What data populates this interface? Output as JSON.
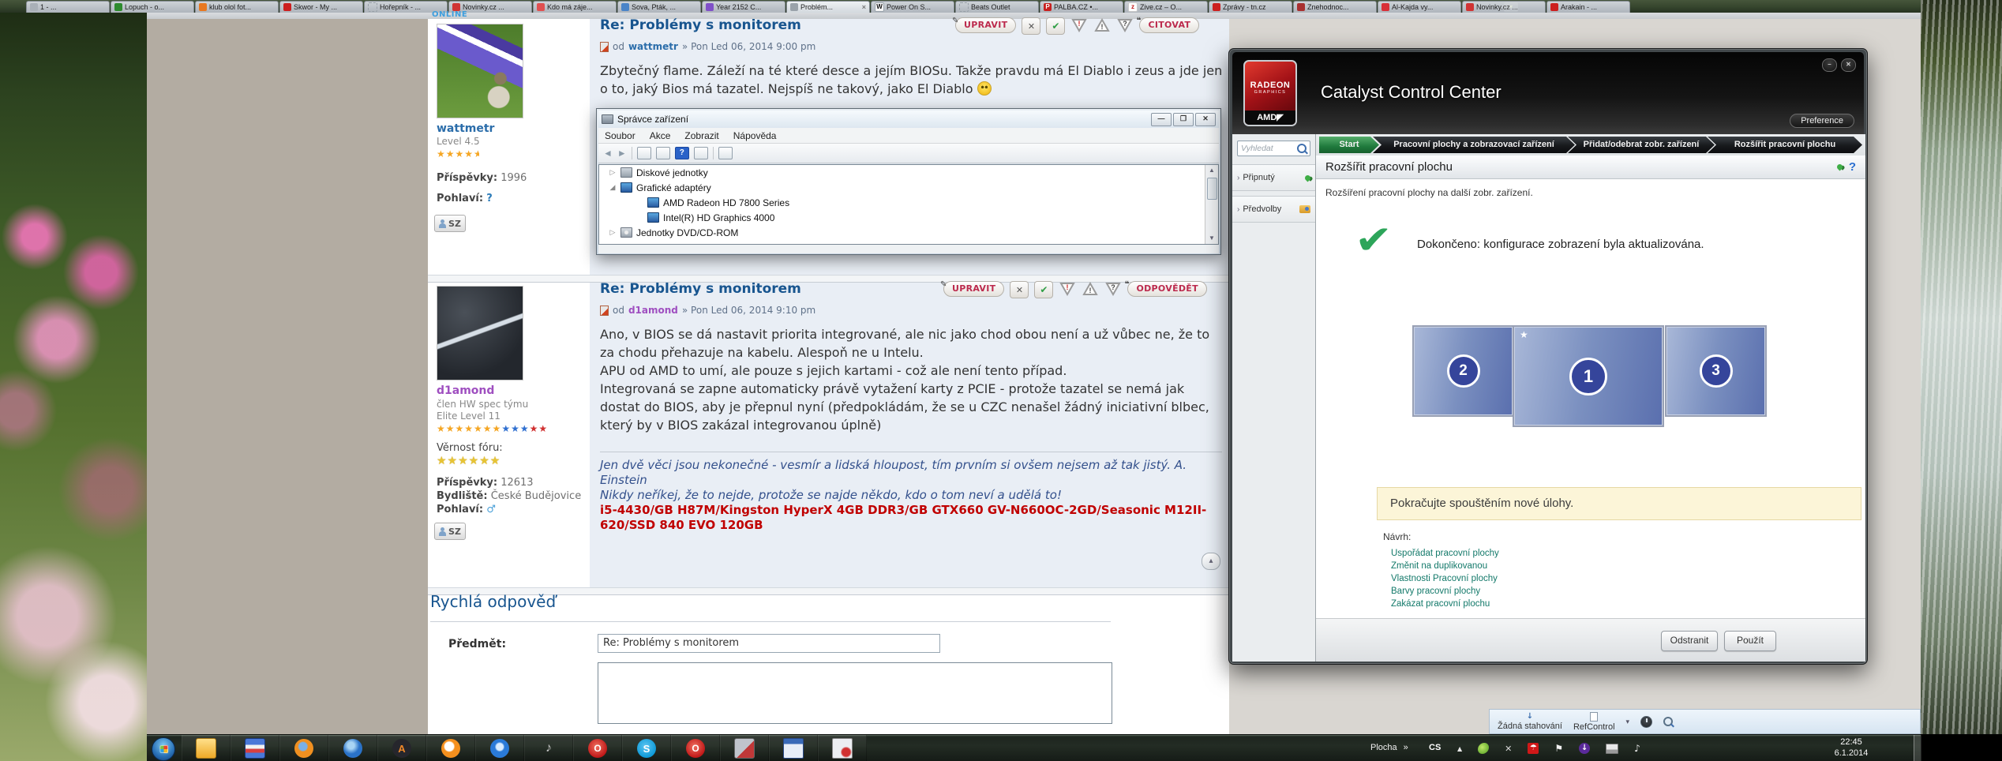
{
  "browser": {
    "new_tab_list_button": "▾",
    "tabs": [
      {
        "cls": "tab",
        "fav": "background:#a9b0b7",
        "glyph": "",
        "label": "1 - ...",
        "close": ""
      },
      {
        "cls": "tab",
        "fav": "background:#2e8b2e",
        "glyph": "",
        "label": "Lopuch - o...",
        "close": ""
      },
      {
        "cls": "tab",
        "fav": "background:#e87820",
        "glyph": "",
        "label": "klub olol fot...",
        "close": ""
      },
      {
        "cls": "tab",
        "fav": "background:#cc1f1f",
        "glyph": "",
        "label": "Skwor - My ...",
        "close": ""
      },
      {
        "cls": "tab",
        "fav": "border:1px dashed #98a0a8",
        "glyph": "",
        "label": "Hořepník - ...",
        "close": ""
      },
      {
        "cls": "tab",
        "fav": "background:#d03434",
        "glyph": "",
        "label": "Novinky.cz ...",
        "close": ""
      },
      {
        "cls": "tab",
        "fav": "background:#e05050",
        "glyph": "",
        "label": "Kdo má záje...",
        "close": ""
      },
      {
        "cls": "tab",
        "fav": "background:#4a84c8",
        "glyph": "",
        "label": "Sova, Pták, ...",
        "close": ""
      },
      {
        "cls": "tab",
        "fav": "background:#8050c8",
        "glyph": "",
        "label": "Year 2152 C...",
        "close": ""
      },
      {
        "cls": "tab active",
        "fav": "background:#9aa2aa",
        "glyph": "",
        "label": "Problém...",
        "close": "×"
      },
      {
        "cls": "tab",
        "fav": "background:#f5f5f5;color:#111;border:1px solid #9aa4ac",
        "glyph": "W",
        "label": "Power On S...",
        "close": ""
      },
      {
        "cls": "tab",
        "fav": "border:1px dashed #98a0a8",
        "glyph": "",
        "label": "Beats Outlet",
        "close": ""
      },
      {
        "cls": "tab",
        "fav": "background:#c82020",
        "glyph": "P",
        "label": "PALBA.CZ •...",
        "close": ""
      },
      {
        "cls": "tab",
        "fav": "background:#ffffff;color:#c01818;border:1px solid #c9c9c9",
        "glyph": "z",
        "label": "Zive.cz – O...",
        "close": ""
      },
      {
        "cls": "tab",
        "fav": "background:#cc1f1f",
        "glyph": "",
        "label": "Zprávy - tn.cz",
        "close": ""
      },
      {
        "cls": "tab",
        "fav": "background:#a83030",
        "glyph": "",
        "label": "Znehodnoc...",
        "close": ""
      },
      {
        "cls": "tab",
        "fav": "background:#d83038",
        "glyph": "",
        "label": "Al-Kajda vy...",
        "close": ""
      },
      {
        "cls": "tab",
        "fav": "background:#d03434",
        "glyph": "",
        "label": "Novinky.cz ...",
        "close": ""
      },
      {
        "cls": "tab",
        "fav": "background:#cc1f1f",
        "glyph": "",
        "label": "Arakain - ...",
        "close": ""
      }
    ],
    "addon_bar": {
      "downloads_icon": "↓",
      "downloads_label": "Žádná stahování",
      "refcontrol_label": "RefControl",
      "caret": "▾"
    }
  },
  "forum": {
    "post_buttons": {
      "edit": "UPRAVIT",
      "edit_pre": "✎",
      "delete": "✕",
      "approve": "✔",
      "report": "!",
      "warn": "!",
      "question": "?",
      "quote": "CITOVAT",
      "quote_pre": "❝",
      "reply": "ODPOVĚDĚT",
      "reply_pre": "❝"
    },
    "post1": {
      "online_badge": "ONLINE",
      "title": "Re: Problémy s monitorem",
      "meta_od": "od",
      "author": "wattmetr",
      "meta_rest": "» Pon Led 06, 2014 9:00 pm",
      "body": "Zbytečný flame. Záleží na té které desce a jejím BIOSu. Takže pravdu má El Diablo i zeus a jde jen o to, jaký Bios má tazatel. Nejspíš ne takový, jako El Diablo",
      "profile": {
        "username": "wattmetr",
        "rank": "Level 4.5",
        "stars_full": "★★★★",
        "star_half": "★",
        "posts_label": "Příspěvky:",
        "posts": "1996",
        "gender_label": "Pohlaví:",
        "gender": "?",
        "pm_button": "SZ"
      }
    },
    "post2": {
      "title": "Re: Problémy s monitorem",
      "meta_od": "od",
      "author": "d1amond",
      "meta_rest": "» Pon Led 06, 2014 9:10 pm",
      "body": "Ano, v BIOS se dá nastavit priorita integrované, ale nic jako chod obou není a už vůbec ne, že to za chodu přehazuje na kabelu. Alespoň ne u Intelu.\nAPU od AMD to umí, ale pouze s jejich kartami - což ale není tento případ.\nIntegrovaná se zapne automaticky právě vytažení karty z PCIE - protože tazatel se nemá jak dostat do BIOS, aby je přepnul nyní (předpokládám, že se u CZC nenašel žádný iniciativní blbec, který by v BIOS zakázal integrovanou úplně)",
      "sig_line1": "Jen dvě věci jsou nekonečné - vesmír a lidská hloupost, tím prvním si ovšem nejsem až tak jistý. A. Einstein",
      "sig_line2": "Nikdy neříkej, že to nejde, protože se najde někdo, kdo o tom neví a udělá to!",
      "sig_hw": "i5-4430/GB H87M/Kingston HyperX 4GB DDR3/GB GTX660 GV-N660OC-2GD/Seasonic M12II-620/SSD 840 EVO 120GB",
      "profile": {
        "username": "d1amond",
        "rank1": "člen HW spec týmu",
        "rank2": "Elite Level 11",
        "stars_orange": "★★★★★★★",
        "stars_blue": "★★★",
        "stars_red": "★★",
        "loyalty_label": "Věrnost fóru:",
        "loyalty_stars": "★★★★★★",
        "posts_label": "Příspěvky:",
        "posts": "12613",
        "location_label": "Bydliště:",
        "location": "České Budějovice",
        "gender_label": "Pohlaví:",
        "gender": "♂",
        "pm_button": "SZ"
      }
    },
    "to_top": "▴",
    "quick_reply": {
      "heading": "Rychlá odpověď",
      "subject_label": "Předmět:",
      "subject_value": "Re: Problémy s monitorem"
    }
  },
  "device_manager": {
    "title": "Správce zařízení",
    "caption_buttons": {
      "min": "—",
      "max": "❐",
      "close": "✕"
    },
    "menu": [
      "Soubor",
      "Akce",
      "Zobrazit",
      "Nápověda"
    ],
    "nav_back": "◄",
    "nav_fwd": "►",
    "help_glyph": "?",
    "scroll_up": "▲",
    "scroll_down": "▼",
    "tree": [
      {
        "expander": "▷",
        "icon_cls": "ticon icon-disk",
        "label": "Diskové jednotky",
        "row_style": "padding-left:12px"
      },
      {
        "expander": "◢",
        "icon_cls": "ticon icon-gpu",
        "label": "Grafické adaptéry",
        "row_style": "padding-left:12px"
      },
      {
        "expander": "",
        "icon_cls": "ticon icon-gpu",
        "label": "AMD Radeon HD 7800 Series",
        "row_style": "padding-left:46px"
      },
      {
        "expander": "",
        "icon_cls": "ticon icon-gpu",
        "label": "Intel(R) HD Graphics 4000",
        "row_style": "padding-left:46px"
      },
      {
        "expander": "▷",
        "icon_cls": "ticon icon-dvd",
        "label": "Jednotky DVD/CD-ROM",
        "row_style": "padding-left:12px"
      }
    ]
  },
  "ccc": {
    "logo_line1": "RADEON",
    "logo_line2": "GRAPHICS",
    "logo_brand": "AMD◤",
    "window_title": "Catalyst Control Center",
    "caption_min": "–",
    "caption_close": "✕",
    "preference_button": "Preference",
    "search_placeholder": "Vyhledat",
    "sidebar": [
      {
        "chev": "›",
        "label": "Připnutý"
      },
      {
        "chev": "›",
        "label": "Předvolby"
      }
    ],
    "breadcrumbs": [
      "Start",
      "Pracovní plochy a zobrazovací zařízení",
      "Přidat/odebrat zobr. zařízení",
      "Rozšířit pracovní plochu"
    ],
    "panel_title": "Rozšířit pracovní plochu",
    "help_glyph": "?",
    "description": "Rozšíření pracovní plochy na další zobr. zařízení.",
    "check_glyph": "✔",
    "status_done": "Dokončeno: konfigurace zobrazení byla aktualizována.",
    "monitors": [
      {
        "n": "2",
        "star": ""
      },
      {
        "n": "1",
        "star": "★"
      },
      {
        "n": "3",
        "star": ""
      }
    ],
    "banner": "Pokračujte spouštěním nové úlohy.",
    "suggestions_label": "Návrh:",
    "suggestions": [
      "Uspořádat pracovní plochy",
      "Změnit na duplikovanou",
      "Vlastnosti Pracovní plochy",
      "Barvy pracovní plochy",
      "Zakázat pracovní plochu"
    ],
    "remove_button": "Odstranit",
    "apply_button": "Použít",
    "accent_green": "#1f7a3c",
    "monitor_blue": "#35459b"
  },
  "taskbar": {
    "plocha_label": "Plocha",
    "plocha_chevrons": "»",
    "language": "CS",
    "clock_time": "22:45",
    "clock_date": "6.1.2014",
    "apps": [
      {
        "name": "explorer-icon",
        "style": "background:linear-gradient(180deg,#ffe08a,#eda928);border-radius:3px;border:1px solid #a87818",
        "glyph": ""
      },
      {
        "name": "total-commander-icon",
        "style": "background:linear-gradient(180deg,#4a78d8 0,#4a78d8 32%,#f2f2f2 32%,#f2f2f2 52%,#d84040 52%,#d84040 72%,#4a78d8 72%);border-radius:3px;border:1px solid #1a3a80",
        "glyph": ""
      },
      {
        "name": "firefox-icon",
        "style": "background:radial-gradient(circle at 45% 40%,#7ab0e8 0 26%,#f09020 34% 78%,#b85a10 90%);border-radius:50%",
        "glyph": ""
      },
      {
        "name": "thunderbird-icon",
        "style": "background:radial-gradient(circle at 40% 35%,#a8d4f4 0 20%,#2a72c8 50%);border-radius:50%",
        "glyph": ""
      },
      {
        "name": "aimp-icon",
        "style": "background:#26262c;border-radius:50%;color:#f08828;font-weight:bold;font-size:13px",
        "glyph": "A"
      },
      {
        "name": "gom-player-icon",
        "style": "background:radial-gradient(circle at 42% 40%,#ffffff 0 28%,#f5901e 36%);border-radius:50%",
        "glyph": ""
      },
      {
        "name": "media-player-icon",
        "style": "background:radial-gradient(circle at 50% 42%,#d8ecff 0 24%,#2a7ad8 34%);border-radius:50%",
        "glyph": ""
      },
      {
        "name": "speaker-icon",
        "style": "color:#c8c8c8;font-size:16px",
        "glyph": "♪"
      },
      {
        "name": "opera-icon",
        "style": "background:radial-gradient(circle at 45% 40%,#f07060,#c01818 70%);border-radius:50%;color:#fff;font-weight:bold;font-size:12px",
        "glyph": "O"
      },
      {
        "name": "skype-icon",
        "style": "background:radial-gradient(circle at 45% 40%,#5ec6f2,#0e9ad8 70%);border-radius:50%;color:#fff;font-weight:bold;font-size:13px",
        "glyph": "S"
      },
      {
        "name": "opera2-icon",
        "style": "background:radial-gradient(circle at 45% 40%,#f07060,#c01818 70%);border-radius:50%;color:#fff;font-weight:bold;font-size:12px",
        "glyph": "O"
      },
      {
        "name": "hardware-tool-icon",
        "style": "background:linear-gradient(135deg,#c0c4cc 0 55%,#c03838 55%);border-radius:3px;border:1px solid #666",
        "glyph": ""
      },
      {
        "name": "management-console-icon",
        "style": "background:linear-gradient(180deg,#3a6ab8 0 28%,#e8eef8 28%);border-radius:2px;border:1px solid #2a4a88",
        "glyph": ""
      },
      {
        "name": "uninstaller-icon",
        "style": "background:radial-gradient(circle at 70% 70%,#d03030 0 22%,#eceef2 30%);border-radius:2px;border:1px solid #888",
        "glyph": ""
      }
    ],
    "tray": [
      {
        "name": "hidden-icons-button",
        "style": "color:#e8e8e8;font-size:8px",
        "glyph": "▲"
      },
      {
        "name": "leaf-icon",
        "style": "width:14px;height:14px;background:radial-gradient(circle at 40% 40%,#bfe868,#4a9a1e);border-radius:60% 40% 60% 40%",
        "glyph": ""
      },
      {
        "name": "x-tool-icon",
        "style": "color:#d8d8d8;font-size:11px;font-weight:bold",
        "glyph": "✕"
      },
      {
        "name": "avira-icon",
        "style": "width:14px;height:14px;background:#d01818;border-radius:2px;color:#fff;font-size:10px;line-height:14px;text-align:center",
        "glyph": "☂"
      },
      {
        "name": "action-center-flag-icon",
        "style": "color:#f0f0f0;font-size:12px",
        "glyph": "⚑"
      },
      {
        "name": "download-manager-icon",
        "style": "width:14px;height:14px;background:#5a2a9a;border-radius:50%;color:#fff;font-size:10px;line-height:14px;text-align:center;font-weight:bold",
        "glyph": "↓"
      },
      {
        "name": "network-icon",
        "style": "width:14px;height:11px;background:linear-gradient(180deg,#e8e8e8 0 60%,#9a9a9a 60%);border:1px solid #777;border-radius:1px",
        "glyph": ""
      },
      {
        "name": "volume-icon",
        "style": "color:#e8e8e8;font-size:12px",
        "glyph": "♪"
      }
    ]
  }
}
